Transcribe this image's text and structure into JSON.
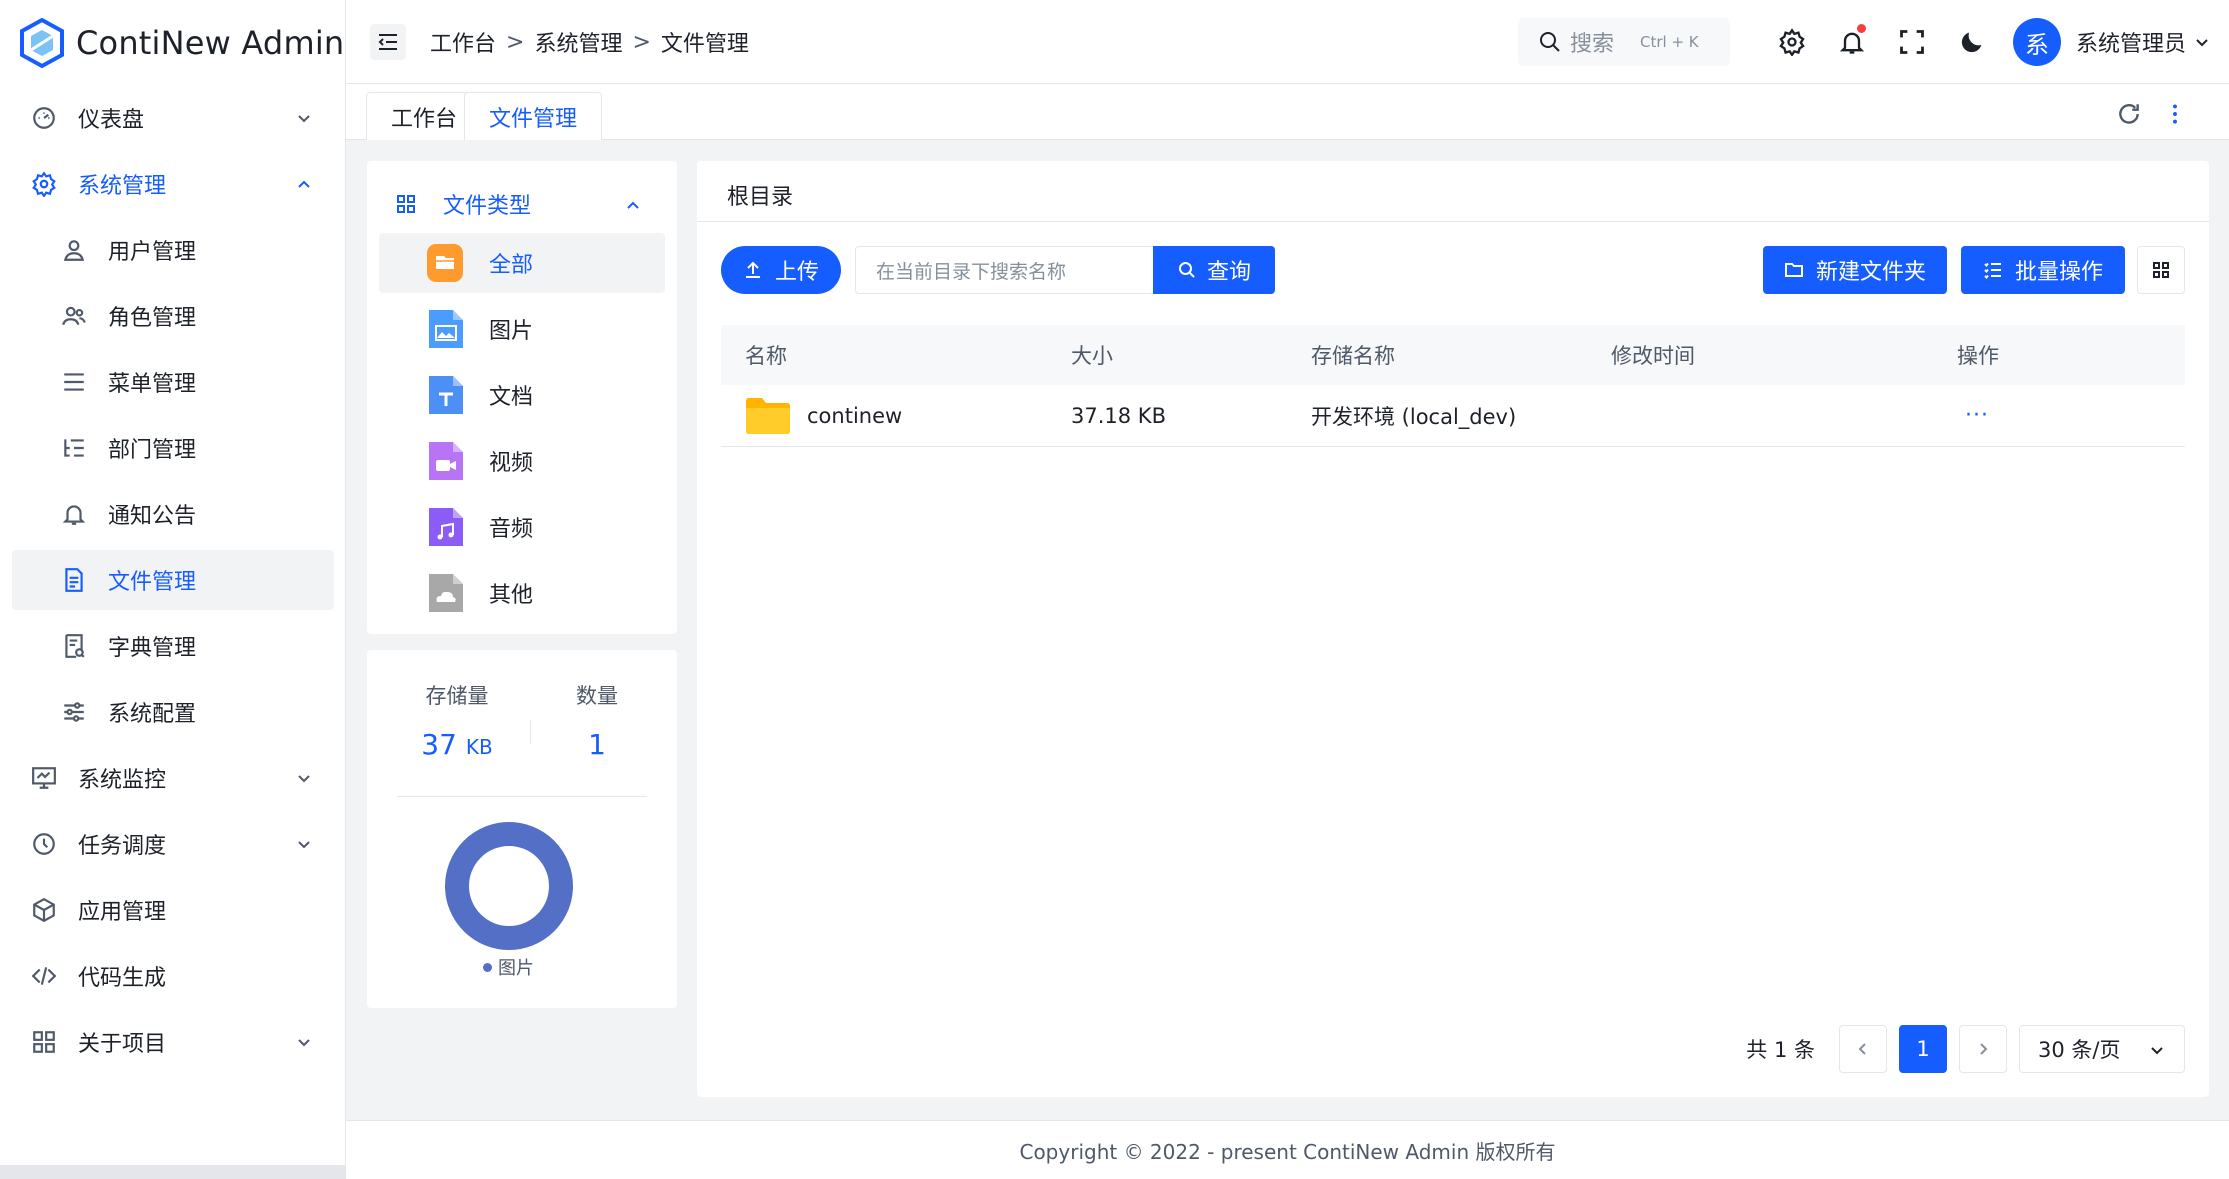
{
  "app": {
    "title": "ContiNew Admin"
  },
  "sidebar": {
    "items": [
      {
        "label": "仪表盘",
        "icon": "dashboard-icon",
        "has_children": true
      },
      {
        "label": "系统管理",
        "icon": "gear-icon",
        "has_children": true,
        "open": true
      },
      {
        "label": "用户管理",
        "icon": "user-icon",
        "sub": true
      },
      {
        "label": "角色管理",
        "icon": "users-icon",
        "sub": true
      },
      {
        "label": "菜单管理",
        "icon": "menu-lines-icon",
        "sub": true
      },
      {
        "label": "部门管理",
        "icon": "list-tree-icon",
        "sub": true
      },
      {
        "label": "通知公告",
        "icon": "bell-icon",
        "sub": true
      },
      {
        "label": "文件管理",
        "icon": "file-icon",
        "sub": true,
        "active": true
      },
      {
        "label": "字典管理",
        "icon": "dictionary-icon",
        "sub": true
      },
      {
        "label": "系统配置",
        "icon": "sliders-icon",
        "sub": true
      },
      {
        "label": "系统监控",
        "icon": "monitor-icon",
        "has_children": true
      },
      {
        "label": "任务调度",
        "icon": "clock-icon",
        "has_children": true
      },
      {
        "label": "应用管理",
        "icon": "cube-icon"
      },
      {
        "label": "代码生成",
        "icon": "code-icon"
      },
      {
        "label": "关于项目",
        "icon": "apps-icon",
        "has_children": true
      }
    ]
  },
  "header": {
    "breadcrumb": [
      "工作台",
      "系统管理",
      "文件管理"
    ],
    "search_label": "搜索",
    "search_shortcut": "Ctrl + K",
    "user_avatar": "系",
    "user_name": "系统管理员"
  },
  "tabs": [
    {
      "label": "工作台"
    },
    {
      "label": "文件管理",
      "active": true
    }
  ],
  "file_types": {
    "title": "文件类型",
    "items": [
      {
        "label": "全部",
        "icon": "all-files-icon",
        "color": "#ff9a2e",
        "active": true
      },
      {
        "label": "图片",
        "icon": "image-file-icon",
        "color": "#4c9bff"
      },
      {
        "label": "文档",
        "icon": "document-file-icon",
        "color": "#4c8ff5"
      },
      {
        "label": "视频",
        "icon": "video-file-icon",
        "color": "#b774f5"
      },
      {
        "label": "音频",
        "icon": "audio-file-icon",
        "color": "#8b5cf6"
      },
      {
        "label": "其他",
        "icon": "other-file-icon",
        "color": "#a8a8a8"
      }
    ]
  },
  "storage": {
    "size_label": "存储量",
    "size_value": "37",
    "size_unit": "KB",
    "count_label": "数量",
    "count_value": "1",
    "chart_legend": "图片",
    "chart_color": "#5470c6"
  },
  "main": {
    "root_title": "根目录",
    "upload_label": "上传",
    "search_placeholder": "在当前目录下搜索名称",
    "query_label": "查询",
    "new_folder_label": "新建文件夹",
    "batch_label": "批量操作",
    "columns": [
      "名称",
      "大小",
      "存储名称",
      "修改时间",
      "操作"
    ],
    "rows": [
      {
        "name": "continew",
        "size": "37.18 KB",
        "storage": "开发环境 (local_dev)",
        "modified": "",
        "action": "···"
      }
    ]
  },
  "pagination": {
    "total": "共 1 条",
    "current_page": "1",
    "page_size": "30 条/页"
  },
  "footer": {
    "copyright": "Copyright © 2022 - present ContiNew Admin 版权所有"
  }
}
